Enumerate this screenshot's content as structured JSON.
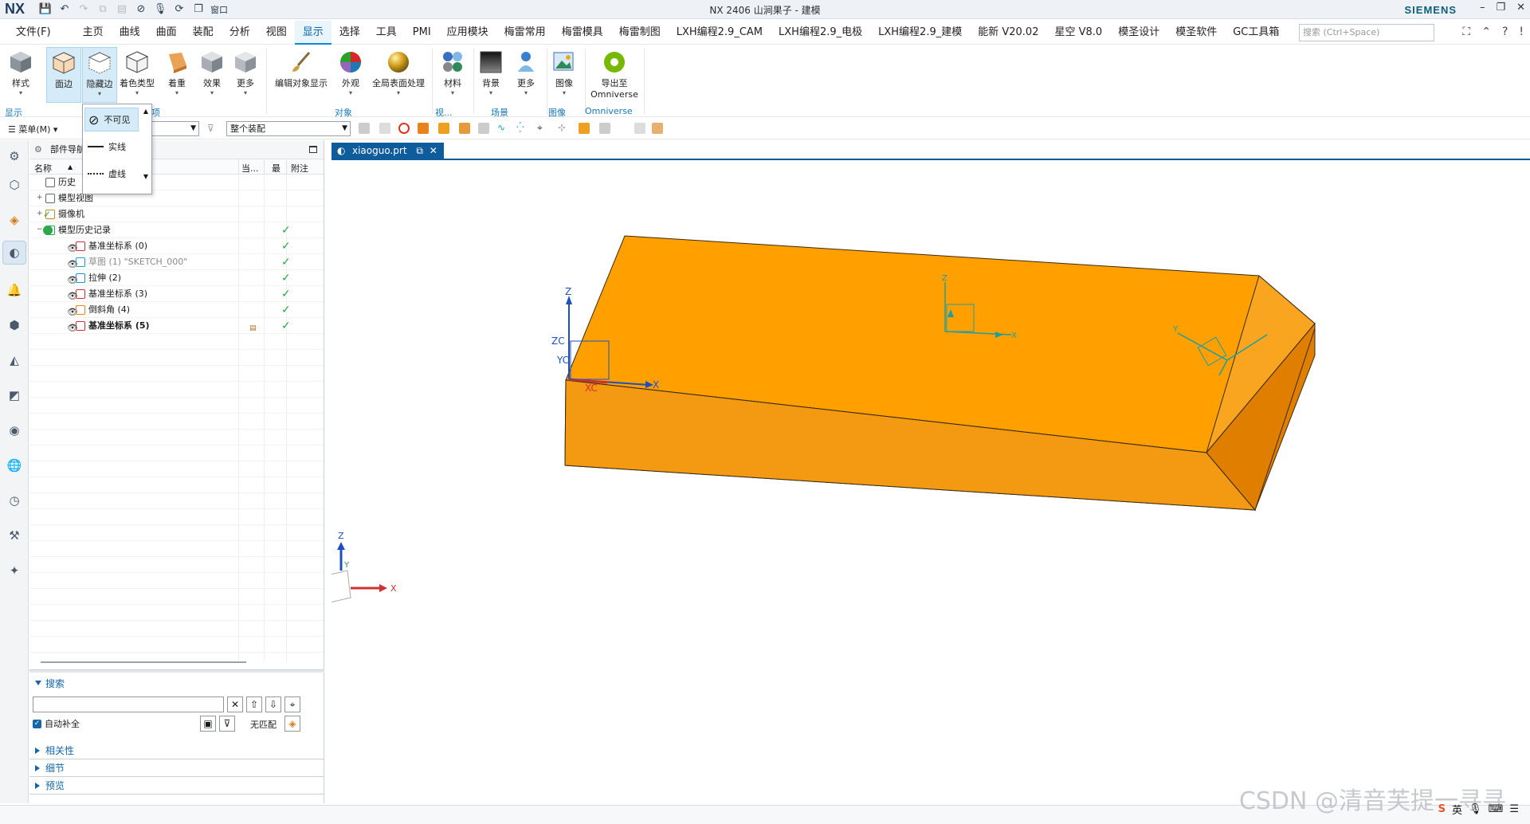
{
  "app": {
    "logo": "NX",
    "title": "NX 2406 山涧果子 - 建模",
    "brand": "SIEMENS",
    "window_menu": "窗口"
  },
  "menubar": {
    "file": "文件(F)",
    "items": [
      "主页",
      "曲线",
      "曲面",
      "装配",
      "分析",
      "视图",
      "显示",
      "选择",
      "工具",
      "PMI",
      "应用模块",
      "梅雷常用",
      "梅雷模具",
      "梅雷制图",
      "LXH编程2.9_CAM",
      "LXH编程2.9_电极",
      "LXH编程2.9_建模",
      "能新 V20.02",
      "星空 V8.0",
      "模圣设计",
      "模圣软件",
      "GC工具箱"
    ],
    "active_index": 6,
    "search_placeholder": "搜索 (Ctrl+Space)"
  },
  "ribbon": {
    "buttons": [
      "样式",
      "面边",
      "隐藏边",
      "着色类型",
      "着重",
      "效果",
      "更多",
      "编辑对象显示",
      "外观",
      "全局表面处理",
      "材料",
      "背景",
      "更多",
      "图像",
      "导出至",
      "Omniverse"
    ],
    "groups": [
      "显示",
      "项",
      "对象",
      "视...",
      "场景",
      "图像",
      "Omniverse"
    ]
  },
  "hidden_edge_popup": {
    "items": [
      "不可见",
      "实线",
      "虚线"
    ],
    "selected": "不可见"
  },
  "toolbar2": {
    "menu_label": "菜单(M)",
    "assembly_scope": "整个装配"
  },
  "navigator": {
    "title": "部件导航器",
    "columns": [
      "名称",
      "当...",
      "最",
      "附注"
    ],
    "rows": [
      {
        "label": "历史",
        "indent": 1,
        "icon": "clock-icon",
        "check": false,
        "style": "normal"
      },
      {
        "label": "模型视图",
        "indent": 1,
        "icon": "view-icon",
        "check": false,
        "style": "normal",
        "expander": "+"
      },
      {
        "label": "摄像机",
        "indent": 1,
        "icon": "camera-icon",
        "check": false,
        "style": "normal",
        "expander": "+"
      },
      {
        "label": "模型历史记录",
        "indent": 1,
        "icon": "history-icon",
        "check": true,
        "style": "normal",
        "expander": "-"
      },
      {
        "label": "基准坐标系 (0)",
        "indent": 2,
        "icon": "datum-csys-icon",
        "check": true,
        "style": "normal"
      },
      {
        "label": "草图 (1) \"SKETCH_000\"",
        "indent": 2,
        "icon": "sketch-icon",
        "check": true,
        "style": "gray"
      },
      {
        "label": "拉伸 (2)",
        "indent": 2,
        "icon": "extrude-icon",
        "check": true,
        "style": "normal"
      },
      {
        "label": "基准坐标系 (3)",
        "indent": 2,
        "icon": "datum-csys-icon",
        "check": true,
        "style": "normal"
      },
      {
        "label": "倒斜角 (4)",
        "indent": 2,
        "icon": "chamfer-icon",
        "check": true,
        "style": "normal"
      },
      {
        "label": "基准坐标系 (5)",
        "indent": 2,
        "icon": "datum-csys-icon",
        "check": true,
        "style": "bold"
      }
    ],
    "search": {
      "title": "搜索",
      "auto_complete": "自动补全",
      "no_match": "无匹配"
    },
    "sections": [
      "相关性",
      "细节",
      "预览"
    ]
  },
  "graphics": {
    "tab_label": "xiaoguo.prt",
    "axis_labels": {
      "z": "Z",
      "x": "X",
      "y": "Y",
      "zc": "ZC",
      "yc": "YC",
      "xc": "XC"
    }
  },
  "colors": {
    "part_top": "#FFA000",
    "part_front": "#F08C0A",
    "part_side": "#E07E00",
    "accent": "#0F5C9C",
    "check": "#27A744"
  },
  "watermark": "CSDN @清音芙提一寻寻",
  "ime_label": "英"
}
